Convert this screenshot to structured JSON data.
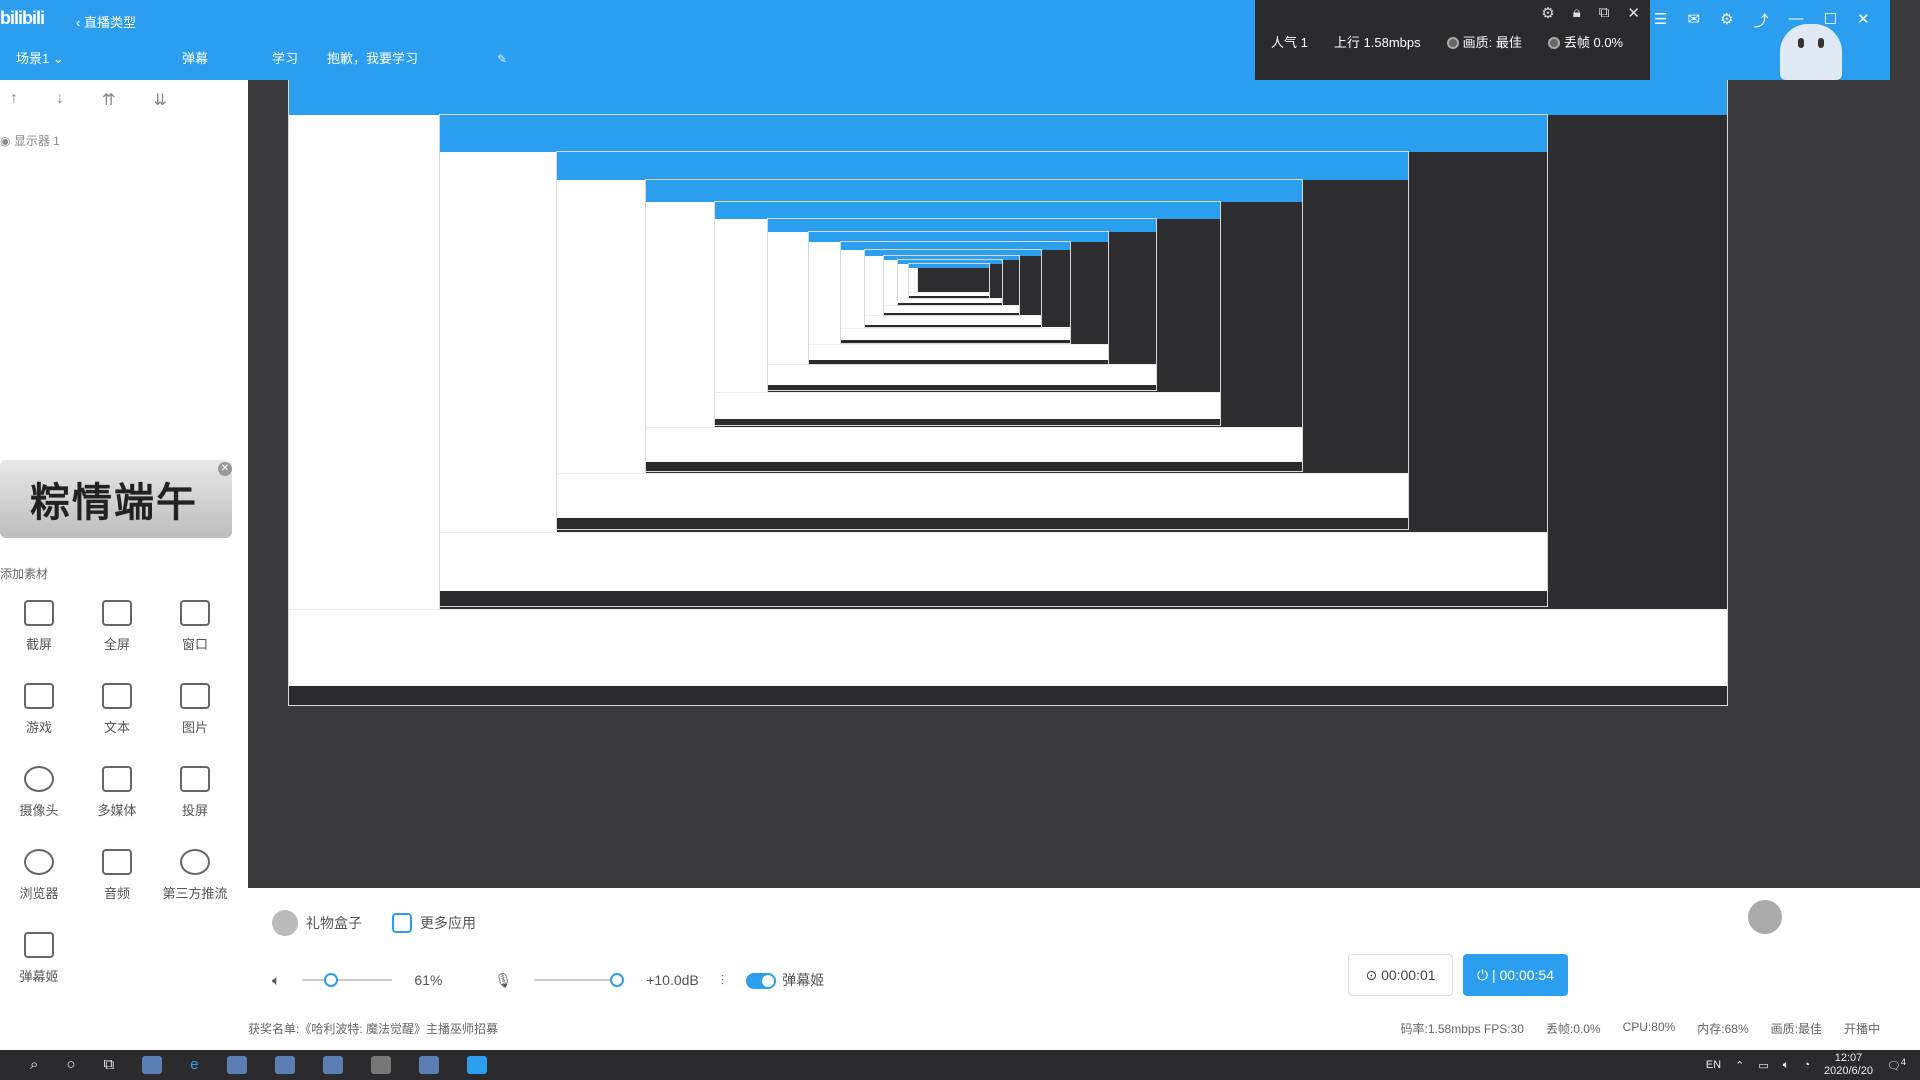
{
  "header": {
    "logo": "bilibili",
    "back_label": "直播类型",
    "tabs": [
      {
        "label": "场景1"
      },
      {
        "label": "弹幕"
      },
      {
        "label": "学习"
      },
      {
        "label": "抱歉，我要学习"
      }
    ],
    "live": {
      "popularity_label": "人气",
      "popularity_value": "1",
      "upload_label": "上行",
      "upload_value": "1.58mbps",
      "quality_label": "画质: 最佳",
      "drop_label": "丢帧",
      "drop_value": "0.0%"
    }
  },
  "left_panel": {
    "display_label": "显示器 1",
    "banner_text": "粽情端午",
    "section_label": "添加素材",
    "items": [
      {
        "label": "截屏",
        "icon": "crop-icon"
      },
      {
        "label": "全屏",
        "icon": "monitor-icon"
      },
      {
        "label": "窗口",
        "icon": "window-icon"
      },
      {
        "label": "游戏",
        "icon": "gamepad-icon"
      },
      {
        "label": "文本",
        "icon": "text-icon"
      },
      {
        "label": "图片",
        "icon": "image-icon"
      },
      {
        "label": "摄像头",
        "icon": "camera-icon"
      },
      {
        "label": "多媒体",
        "icon": "media-icon"
      },
      {
        "label": "投屏",
        "icon": "phone-icon"
      },
      {
        "label": "浏览器",
        "icon": "browser-icon"
      },
      {
        "label": "音频",
        "icon": "music-icon"
      },
      {
        "label": "第三方推流",
        "icon": "stream-icon"
      },
      {
        "label": "弹幕姬",
        "icon": "danmaku-icon"
      }
    ]
  },
  "bottom": {
    "gift_box": "礼物盒子",
    "more_apps": "更多应用",
    "volume_pct": "61%",
    "mic_db": "+10.0dB",
    "danmaku_toggle": "弹幕姬",
    "timer_left": "00:00:01",
    "timer_right": "00:00:54",
    "status_left": "获奖名单:《哈利波特: 魔法觉醒》主播巫师招募",
    "status_right": [
      "码率:1.58mbps FPS:30",
      "丢帧:0.0%",
      "CPU:80%",
      "内存:68%",
      "画质:最佳",
      "开播中"
    ]
  },
  "taskbar": {
    "lang": "EN",
    "time": "12:07",
    "date": "2020/6/20",
    "notif_count": "4"
  },
  "colors": {
    "accent": "#2c9eef",
    "dark": "#2b2b2e"
  }
}
